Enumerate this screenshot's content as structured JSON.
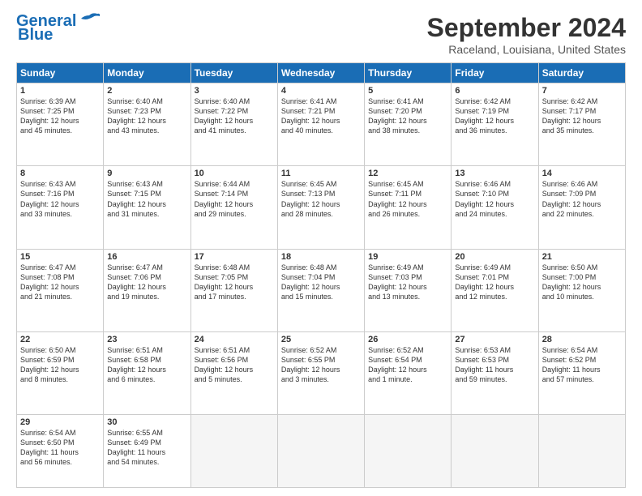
{
  "logo": {
    "line1": "General",
    "line2": "Blue"
  },
  "title": "September 2024",
  "location": "Raceland, Louisiana, United States",
  "days_header": [
    "Sunday",
    "Monday",
    "Tuesday",
    "Wednesday",
    "Thursday",
    "Friday",
    "Saturday"
  ],
  "weeks": [
    [
      {
        "day": "1",
        "info": "Sunrise: 6:39 AM\nSunset: 7:25 PM\nDaylight: 12 hours\nand 45 minutes."
      },
      {
        "day": "2",
        "info": "Sunrise: 6:40 AM\nSunset: 7:23 PM\nDaylight: 12 hours\nand 43 minutes."
      },
      {
        "day": "3",
        "info": "Sunrise: 6:40 AM\nSunset: 7:22 PM\nDaylight: 12 hours\nand 41 minutes."
      },
      {
        "day": "4",
        "info": "Sunrise: 6:41 AM\nSunset: 7:21 PM\nDaylight: 12 hours\nand 40 minutes."
      },
      {
        "day": "5",
        "info": "Sunrise: 6:41 AM\nSunset: 7:20 PM\nDaylight: 12 hours\nand 38 minutes."
      },
      {
        "day": "6",
        "info": "Sunrise: 6:42 AM\nSunset: 7:19 PM\nDaylight: 12 hours\nand 36 minutes."
      },
      {
        "day": "7",
        "info": "Sunrise: 6:42 AM\nSunset: 7:17 PM\nDaylight: 12 hours\nand 35 minutes."
      }
    ],
    [
      {
        "day": "8",
        "info": "Sunrise: 6:43 AM\nSunset: 7:16 PM\nDaylight: 12 hours\nand 33 minutes."
      },
      {
        "day": "9",
        "info": "Sunrise: 6:43 AM\nSunset: 7:15 PM\nDaylight: 12 hours\nand 31 minutes."
      },
      {
        "day": "10",
        "info": "Sunrise: 6:44 AM\nSunset: 7:14 PM\nDaylight: 12 hours\nand 29 minutes."
      },
      {
        "day": "11",
        "info": "Sunrise: 6:45 AM\nSunset: 7:13 PM\nDaylight: 12 hours\nand 28 minutes."
      },
      {
        "day": "12",
        "info": "Sunrise: 6:45 AM\nSunset: 7:11 PM\nDaylight: 12 hours\nand 26 minutes."
      },
      {
        "day": "13",
        "info": "Sunrise: 6:46 AM\nSunset: 7:10 PM\nDaylight: 12 hours\nand 24 minutes."
      },
      {
        "day": "14",
        "info": "Sunrise: 6:46 AM\nSunset: 7:09 PM\nDaylight: 12 hours\nand 22 minutes."
      }
    ],
    [
      {
        "day": "15",
        "info": "Sunrise: 6:47 AM\nSunset: 7:08 PM\nDaylight: 12 hours\nand 21 minutes."
      },
      {
        "day": "16",
        "info": "Sunrise: 6:47 AM\nSunset: 7:06 PM\nDaylight: 12 hours\nand 19 minutes."
      },
      {
        "day": "17",
        "info": "Sunrise: 6:48 AM\nSunset: 7:05 PM\nDaylight: 12 hours\nand 17 minutes."
      },
      {
        "day": "18",
        "info": "Sunrise: 6:48 AM\nSunset: 7:04 PM\nDaylight: 12 hours\nand 15 minutes."
      },
      {
        "day": "19",
        "info": "Sunrise: 6:49 AM\nSunset: 7:03 PM\nDaylight: 12 hours\nand 13 minutes."
      },
      {
        "day": "20",
        "info": "Sunrise: 6:49 AM\nSunset: 7:01 PM\nDaylight: 12 hours\nand 12 minutes."
      },
      {
        "day": "21",
        "info": "Sunrise: 6:50 AM\nSunset: 7:00 PM\nDaylight: 12 hours\nand 10 minutes."
      }
    ],
    [
      {
        "day": "22",
        "info": "Sunrise: 6:50 AM\nSunset: 6:59 PM\nDaylight: 12 hours\nand 8 minutes."
      },
      {
        "day": "23",
        "info": "Sunrise: 6:51 AM\nSunset: 6:58 PM\nDaylight: 12 hours\nand 6 minutes."
      },
      {
        "day": "24",
        "info": "Sunrise: 6:51 AM\nSunset: 6:56 PM\nDaylight: 12 hours\nand 5 minutes."
      },
      {
        "day": "25",
        "info": "Sunrise: 6:52 AM\nSunset: 6:55 PM\nDaylight: 12 hours\nand 3 minutes."
      },
      {
        "day": "26",
        "info": "Sunrise: 6:52 AM\nSunset: 6:54 PM\nDaylight: 12 hours\nand 1 minute."
      },
      {
        "day": "27",
        "info": "Sunrise: 6:53 AM\nSunset: 6:53 PM\nDaylight: 11 hours\nand 59 minutes."
      },
      {
        "day": "28",
        "info": "Sunrise: 6:54 AM\nSunset: 6:52 PM\nDaylight: 11 hours\nand 57 minutes."
      }
    ],
    [
      {
        "day": "29",
        "info": "Sunrise: 6:54 AM\nSunset: 6:50 PM\nDaylight: 11 hours\nand 56 minutes."
      },
      {
        "day": "30",
        "info": "Sunrise: 6:55 AM\nSunset: 6:49 PM\nDaylight: 11 hours\nand 54 minutes."
      },
      {
        "day": "",
        "info": ""
      },
      {
        "day": "",
        "info": ""
      },
      {
        "day": "",
        "info": ""
      },
      {
        "day": "",
        "info": ""
      },
      {
        "day": "",
        "info": ""
      }
    ]
  ]
}
